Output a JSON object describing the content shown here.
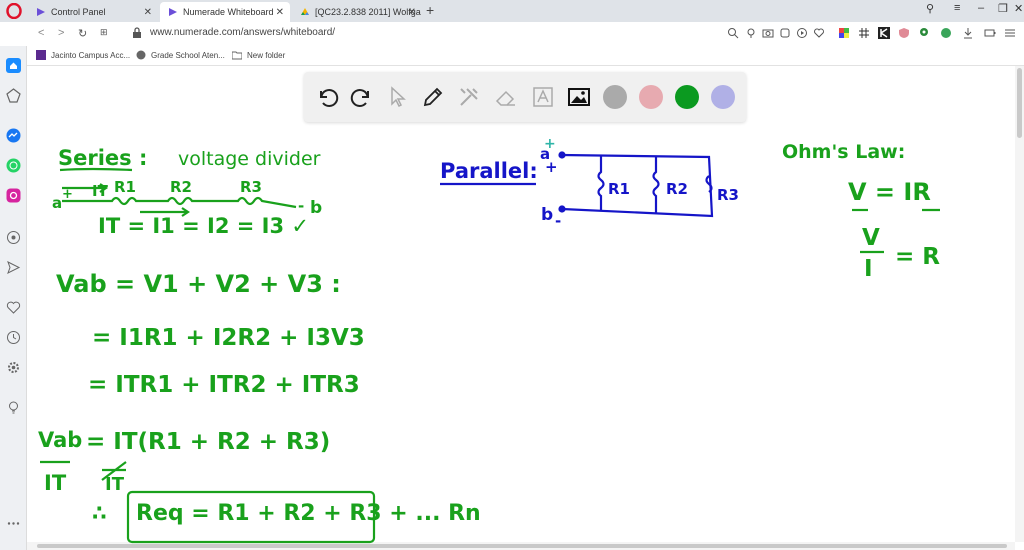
{
  "tabs": [
    {
      "title": "Control Panel",
      "active": false
    },
    {
      "title": "Numerade Whiteboard",
      "active": true
    },
    {
      "title": "[QC23.2.838 2011] Wolfga",
      "active": false
    }
  ],
  "url": "www.numerade.com/answers/whiteboard/",
  "bookmarks": [
    {
      "label": "Jacinto Campus Acc..."
    },
    {
      "label": "Grade School Aten..."
    },
    {
      "label": "New folder"
    }
  ],
  "colors": {
    "swatch_gray": "#aaaaaa",
    "swatch_pink": "#e7aab0",
    "swatch_green": "#0b9a20",
    "swatch_lavender": "#b0b0e6",
    "ink_green": "#19a11c",
    "ink_blue": "#1515c8"
  },
  "board": {
    "series": {
      "title": "Series :",
      "note": "voltage divider",
      "a": "a",
      "plus": "+",
      "it": "IT",
      "r1": "R1",
      "r2": "R2",
      "r3": "R3",
      "minus": "-",
      "b": "b",
      "current_eq": "IT = I1 = I2 = I3 ✓"
    },
    "eq": {
      "vab": "Vab = V1 + V2 + V3   :",
      "line2": "= I1R1 + I2R2 + I3V3",
      "line3": "= ITR1 + ITR2 + ITR3",
      "line4": "= IT(R1 + R2 + R3)",
      "frac_num": "Vab",
      "frac_den": "IT",
      "frac_it": "IT",
      "therefore": "∴",
      "req": "Req = R1 + R2 + R3 + ... Rn"
    },
    "parallel": {
      "title": "Parallel:",
      "a": "a",
      "plus_top": "+",
      "plus": "+",
      "b": "b",
      "minus": "-",
      "r1": "R1",
      "r2": "R2",
      "r3": "R3"
    },
    "ohm": {
      "title": "Ohm's Law:",
      "eq1": "V = IR",
      "num": "V",
      "den": "I",
      "eq2_rhs": "= R"
    }
  }
}
